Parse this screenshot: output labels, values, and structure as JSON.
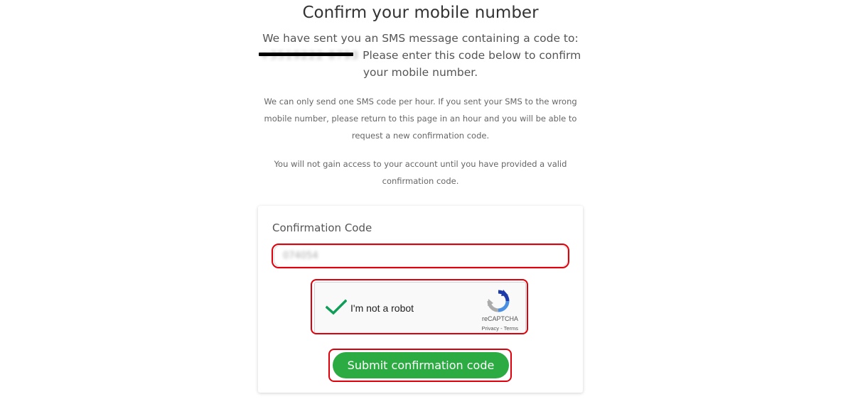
{
  "page": {
    "title": "Confirm your mobile number",
    "lead_before": "We have sent you an SMS message containing a code to:",
    "phone_masked": "+3519222 8793",
    "lead_after": "Please enter this code below to confirm your mobile number.",
    "note1": "We can only send one SMS code per hour. If you sent your SMS to the wrong mobile number, please return to this page in an hour and you will be able to request a new confirmation code.",
    "note2": "You will not gain access to your account until you have provided a valid confirmation code."
  },
  "form": {
    "label": "Confirmation Code",
    "code_value": "074054",
    "submit_label": "Submit confirmation code"
  },
  "recaptcha": {
    "label": "I'm not a robot",
    "brand": "reCAPTCHA",
    "privacy": "Privacy",
    "separator": " - ",
    "terms": "Terms",
    "checked": true
  },
  "colors": {
    "submit": "#2bab42",
    "highlight": "#e0000b",
    "check": "#0f9d58"
  }
}
